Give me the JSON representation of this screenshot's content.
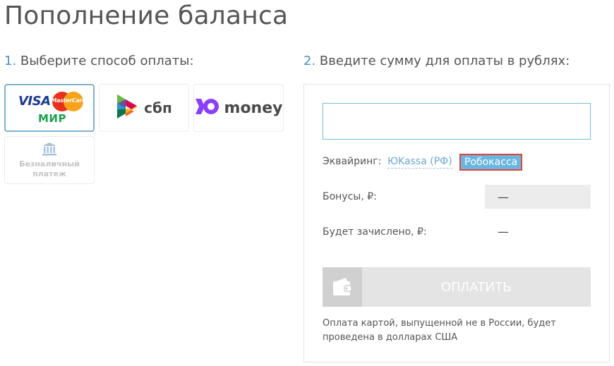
{
  "page": {
    "title": "Пополнение баланса"
  },
  "step1": {
    "number": "1.",
    "label": "Выберите способ оплаты:"
  },
  "step2": {
    "number": "2.",
    "label": "Введите сумму для оплаты в рублях:"
  },
  "payment_methods": [
    {
      "id": "card",
      "selected": true,
      "visa": "VISA",
      "mastercard": "MasterCard",
      "mir": "МИР"
    },
    {
      "id": "sbp",
      "selected": false,
      "label": "сбп"
    },
    {
      "id": "yoomoney",
      "selected": false,
      "label": "money"
    },
    {
      "id": "bank",
      "selected": false,
      "label_line1": "Безналичный",
      "label_line2": "платеж"
    }
  ],
  "amount": {
    "value": "",
    "placeholder": ""
  },
  "acquiring": {
    "label": "Эквайринг:",
    "options": [
      "ЮKassa (РФ)",
      "Робокасса"
    ],
    "selected": "Робокасса"
  },
  "bonuses": {
    "label": "Бонусы, ₽:",
    "value": "—"
  },
  "credited": {
    "label": "Будет зачислено, ₽:",
    "value": "—"
  },
  "pay_button": {
    "label": "ОПЛАТИТЬ"
  },
  "note": "Оплата картой, выпущенной не в России, будет проведена в долларах США",
  "colors": {
    "accent": "#4a90c4",
    "input_border": "#76c0cf",
    "robokassa_bg": "#6bb6e0",
    "robokassa_border": "#e0433a",
    "button_bg": "#e4e4e4"
  },
  "icons": [
    "bank-icon",
    "wallet-icon",
    "sbp-logo-icon",
    "yoomoney-logo-icon"
  ]
}
